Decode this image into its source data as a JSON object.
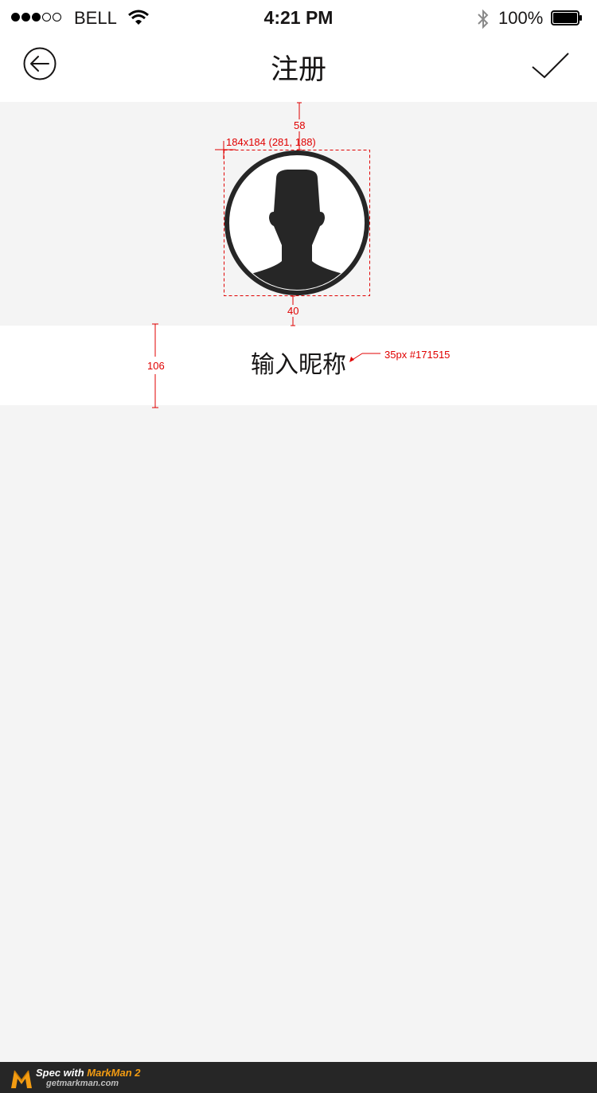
{
  "status_bar": {
    "carrier": "BELL",
    "time": "4:21 PM",
    "battery_text": "100%",
    "signal_bars_filled": 3,
    "signal_bars_total": 5,
    "icons": [
      "wifi-icon",
      "bluetooth-icon",
      "battery-icon"
    ]
  },
  "nav": {
    "title": "注册",
    "back_icon": "back-arrow-circle-icon",
    "confirm_icon": "checkmark-icon"
  },
  "avatar": {
    "icon": "user-avatar-icon"
  },
  "nickname": {
    "placeholder": "输入昵称",
    "value": ""
  },
  "annotations": {
    "avatar_top_gap": "58",
    "avatar_box": "184x184 (281, 188)",
    "avatar_bottom_gap": "40",
    "row_height": "106",
    "font_spec": "35px #171515"
  },
  "footer": {
    "brand_prefix": "Spec with ",
    "brand_name": "MarkMan 2",
    "url": "getmarkman.com"
  },
  "colors": {
    "background": "#f4f4f4",
    "text": "#171515",
    "annotation": "#e00000",
    "footer": "#262626",
    "footer_accent": "#f39c12"
  }
}
